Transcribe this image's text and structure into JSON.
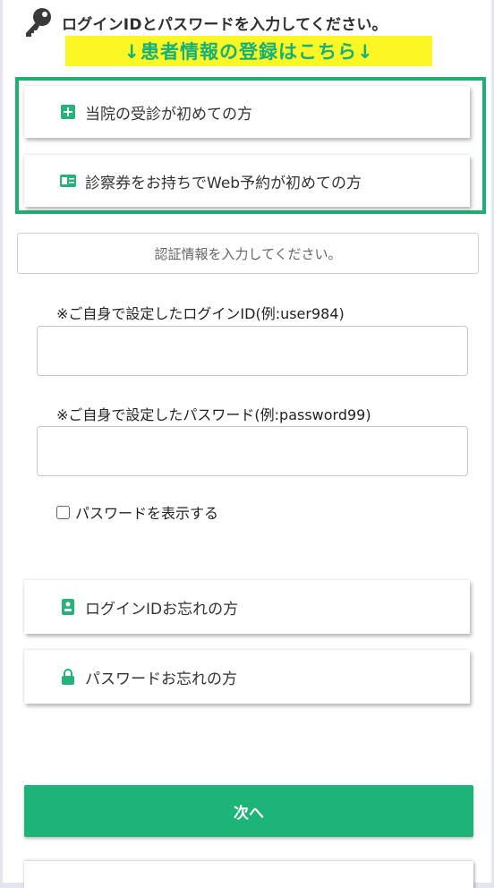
{
  "header": {
    "instruction": "ログインIDとパスワードを入力してください。",
    "register_banner": "↓患者情報の登録はこちら↓"
  },
  "register_options": {
    "first_visit_label": "当院の受診が初めての方",
    "card_first_web_label": "診察券をお持ちでWeb予約が初めての方"
  },
  "auth": {
    "prompt": "認証情報を入力してください。",
    "login_id_label": "※ご自身で設定したログインID(例:user984)",
    "login_id_value": "",
    "password_label": "※ご自身で設定したパスワード(例:password99)",
    "password_value": "",
    "show_password_label": "パスワードを表示する"
  },
  "recovery": {
    "forgot_login_id_label": "ログインIDお忘れの方",
    "forgot_password_label": "パスワードお忘れの方"
  },
  "actions": {
    "next_label": "次へ"
  },
  "colors": {
    "accent_green": "#1db477",
    "banner_yellow": "#fbf725",
    "border_green": "#1db070"
  },
  "icons": {
    "header": "key-icon",
    "first_visit": "plus-square-icon",
    "card": "id-card-icon",
    "forgot_id": "badge-icon",
    "forgot_password": "lock-icon"
  }
}
